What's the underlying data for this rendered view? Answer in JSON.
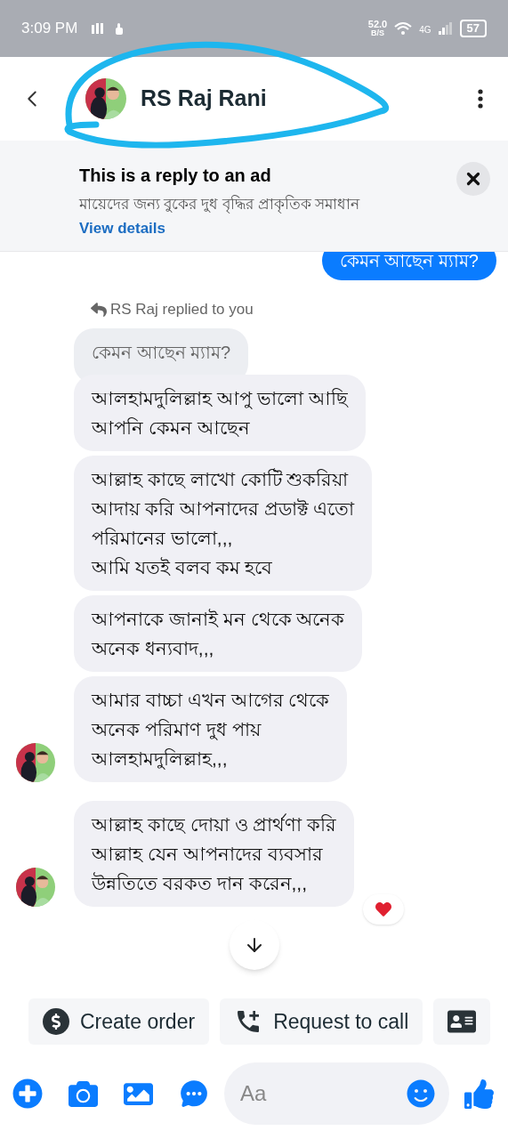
{
  "status_bar": {
    "time": "3:09 PM",
    "network_speed": "52.0",
    "speed_unit": "B/S",
    "network": "4G",
    "battery": "57"
  },
  "header": {
    "title": "RS Raj Rani"
  },
  "ad_banner": {
    "title": "This is a reply to an ad",
    "text": "মায়েদের জন্য বুকের দুধ বৃদ্ধির প্রাকৃতিক সমাধান",
    "link": "View details"
  },
  "messages": [
    {
      "kind": "sent",
      "text": "কেমন আছেন ম্যাম?"
    },
    {
      "kind": "reply_label",
      "text": "RS Raj replied to you"
    },
    {
      "kind": "quoted",
      "text": "কেমন আছেন ম্যাম?"
    },
    {
      "kind": "received",
      "text": "আলহামদুলিল্লাহ আপু ভালো আছি\nআপনি কেমন আছেন",
      "show_avatar": false,
      "reacted": false
    },
    {
      "kind": "received",
      "text": "আল্লাহ কাছে লাখো কোটি শুকরিয়া\nআদায় করি আপনাদের প্রডাক্ট এতো\nপরিমানের ভালো,,,\nআমি যতই বলব কম হবে",
      "show_avatar": false,
      "reacted": false
    },
    {
      "kind": "received",
      "text": "আপনাকে জানাই মন থেকে অনেক\nঅনেক ধন্যবাদ,,,",
      "show_avatar": false,
      "reacted": false
    },
    {
      "kind": "received",
      "text": "আমার বাচ্চা এখন আগের থেকে\nঅনেক পরিমাণ দুধ পায়\nআলহামদুলিল্লাহ,,,",
      "show_avatar": true,
      "reacted": false
    },
    {
      "kind": "received",
      "text": "আল্লাহ কাছে দোয়া ও প্রার্থণা করি\nআল্লাহ যেন আপনাদের ব্যবসার\nউন্নতিতে বরকত দান করেন,,,",
      "show_avatar": true,
      "reacted": true
    }
  ],
  "quick_actions": [
    {
      "kind": "order",
      "label": "Create order"
    },
    {
      "kind": "call",
      "label": "Request to call"
    },
    {
      "kind": "contact"
    }
  ],
  "composer": {
    "placeholder": "Aa"
  }
}
